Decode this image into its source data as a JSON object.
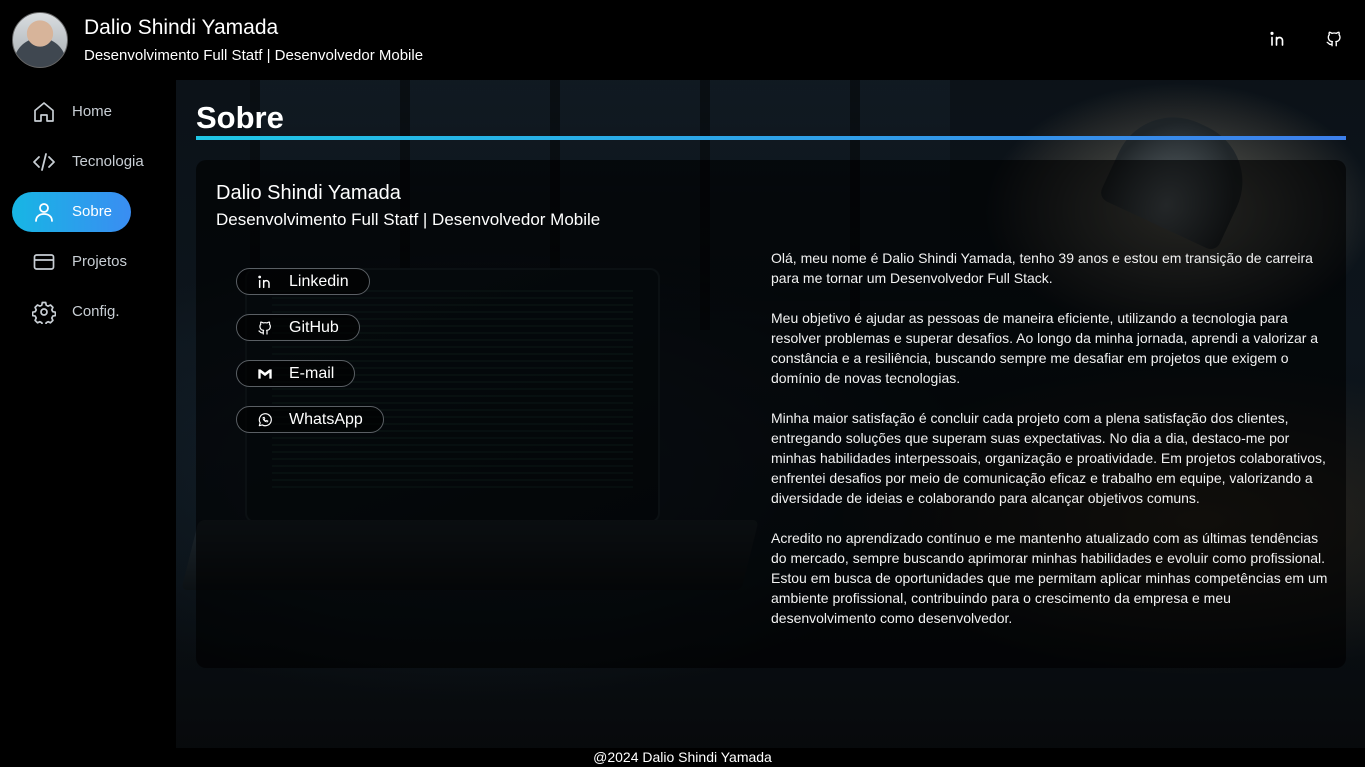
{
  "header": {
    "name": "Dalio Shindi Yamada",
    "subtitle": "Desenvolvimento Full Statf | Desenvolvedor Mobile",
    "icons": [
      "linkedin-icon",
      "github-icon"
    ]
  },
  "sidebar": {
    "items": [
      {
        "label": "Home",
        "icon": "home-icon",
        "active": false
      },
      {
        "label": "Tecnologia",
        "icon": "code-icon",
        "active": false
      },
      {
        "label": "Sobre",
        "icon": "user-icon",
        "active": true
      },
      {
        "label": "Projetos",
        "icon": "card-icon",
        "active": false
      },
      {
        "label": "Config.",
        "icon": "gear-icon",
        "active": false
      }
    ],
    "active_gradient": [
      "#17b6e4",
      "#3a8df2"
    ]
  },
  "main": {
    "title": "Sobre",
    "card": {
      "name": "Dalio Shindi Yamada",
      "subtitle": "Desenvolvimento Full Statf | Desenvolvedor Mobile",
      "contacts": [
        {
          "label": "Linkedin",
          "icon": "linkedin-icon"
        },
        {
          "label": "GitHub",
          "icon": "github-icon"
        },
        {
          "label": "E-mail",
          "icon": "gmail-icon"
        },
        {
          "label": "WhatsApp",
          "icon": "whatsapp-icon"
        }
      ],
      "paragraphs": [
        "Olá, meu nome é Dalio Shindi Yamada, tenho 39 anos e estou em transição de carreira para me tornar um Desenvolvedor Full Stack.",
        "Meu objetivo é ajudar as pessoas de maneira eficiente, utilizando a tecnologia para resolver problemas e superar desafios. Ao longo da minha jornada, aprendi a valorizar a constância e a resiliência, buscando sempre me desafiar em projetos que exigem o domínio de novas tecnologias.",
        "Minha maior satisfação é concluir cada projeto com a plena satisfação dos clientes, entregando soluções que superam suas expectativas. No dia a dia, destaco-me por minhas habilidades interpessoais, organização e proatividade. Em projetos colaborativos, enfrentei desafios por meio de comunicação eficaz e trabalho em equipe, valorizando a diversidade de ideias e colaborando para alcançar objetivos comuns.",
        "Acredito no aprendizado contínuo e me mantenho atualizado com as últimas tendências do mercado, sempre buscando aprimorar minhas habilidades e evoluir como profissional. Estou em busca de oportunidades que me permitam aplicar minhas competências em um ambiente profissional, contribuindo para o crescimento da empresa e meu desenvolvimento como desenvolvedor."
      ]
    }
  },
  "footer": {
    "text": "@2024 Dalio Shindi Yamada"
  }
}
